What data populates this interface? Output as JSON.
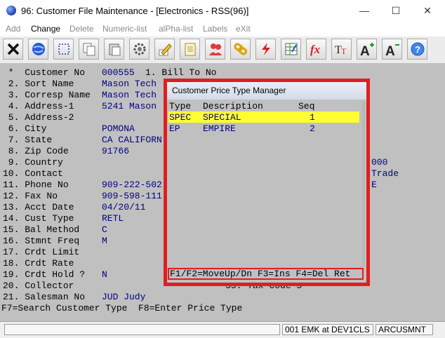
{
  "window": {
    "title": "96: Customer File Maintenance - [Electronics - RSS(96)]",
    "minimize": "—",
    "maximize": "☐",
    "close": "✕"
  },
  "menu": [
    "Add",
    "Change",
    "Delete",
    "Numeric-list",
    "alPha-list",
    "Labels",
    "eXit"
  ],
  "toolbar_icons": [
    "close-x-icon",
    "globe-icon",
    "select-box-icon",
    "copy-icon",
    "paste-icon",
    "gear-icon",
    "edit-pencil-icon",
    "notepad-icon",
    "users-icon",
    "chain-link-icon",
    "lightning-icon",
    "spreadsheet-icon",
    "function-fx-icon",
    "text-format-icon",
    "font-increase-icon",
    "font-decrease-icon",
    "help-icon"
  ],
  "fields": [
    {
      "label": " *  Customer No",
      "value": "000555"
    },
    {
      "label": " 2. Sort Name",
      "value": "Mason Tech"
    },
    {
      "label": " 3. Corresp Name",
      "value": "Mason Tech"
    },
    {
      "label": " 4. Address-1",
      "value": "5241 Mason"
    },
    {
      "label": " 5. Address-2",
      "value": ""
    },
    {
      "label": " 6. City",
      "value": "POMONA"
    },
    {
      "label": " 7. State",
      "value": "CA CALIFORN"
    },
    {
      "label": " 8. Zip Code",
      "value": "91766"
    },
    {
      "label": " 9. Country",
      "value": ""
    },
    {
      "label": "10. Contact",
      "value": ""
    },
    {
      "label": "11. Phone No",
      "value": "909-222-502"
    },
    {
      "label": "12. Fax No",
      "value": "909-598-111"
    },
    {
      "label": "13. Acct Date",
      "value": "04/20/11"
    },
    {
      "label": "14. Cust Type",
      "value": "RETL"
    },
    {
      "label": "15. Bal Method",
      "value": "C"
    },
    {
      "label": "16. Stmnt Freq",
      "value": "M"
    },
    {
      "label": "17. Crdt Limit",
      "value": ""
    },
    {
      "label": "18. Crdt Rate",
      "value": ""
    },
    {
      "label": "19. Crdt Hold ?",
      "value": "N"
    },
    {
      "label": "20. Collector",
      "value": ""
    },
    {
      "label": "21. Salesman No",
      "value": "JUD Judy"
    }
  ],
  "bill_to": "1. Bill To No",
  "right_values": [
    "000",
    "Trade",
    "E"
  ],
  "tax_code": "33. Tax Code 5",
  "popup": {
    "title": "Customer Price Type Manager",
    "headers": {
      "type": "Type",
      "description": "Description",
      "seq": "Seq"
    },
    "rows": [
      {
        "type": "SPEC",
        "description": "SPECIAL",
        "seq": "1"
      },
      {
        "type": "EP",
        "description": "EMPIRE",
        "seq": "2"
      }
    ],
    "footer": "F1/F2=MoveUp/Dn F3=Ins F4=Del Ret"
  },
  "function_line": "F7=Search Customer Type  F8=Enter Price Type",
  "status": {
    "left": "",
    "user": "001 EMK at DEV1CLS",
    "system": "ARCUSMNT"
  }
}
